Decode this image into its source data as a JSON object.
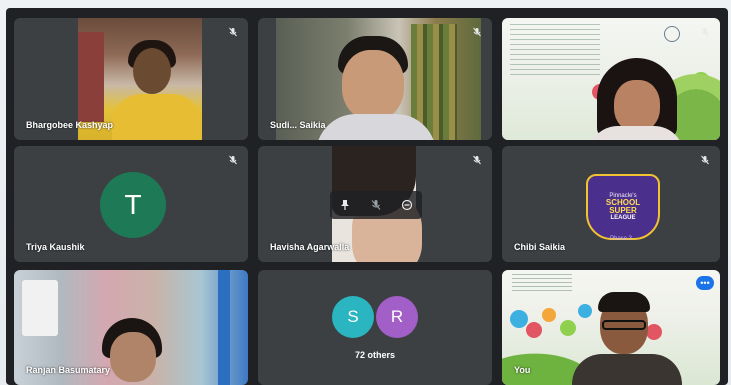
{
  "participants": [
    {
      "name": "Bhargobee Kashyap",
      "muted": true
    },
    {
      "name": "Sudi... Saikia",
      "muted": true
    },
    {
      "name": "",
      "muted": true
    },
    {
      "name": "Triya Kaushik",
      "muted": true,
      "avatar_letter": "T",
      "avatar_color": "#1e7a56"
    },
    {
      "name": "Havisha Agarwalla",
      "muted": true
    },
    {
      "name": "Chibi Saikia",
      "muted": true,
      "badge": {
        "top": "Pinnacle's",
        "line1": "SCHOOL",
        "line2": "SUPER",
        "line3": "LEAGUE",
        "foot": "Phase 3"
      }
    },
    {
      "name": "Ranjan Basumatary",
      "muted": false
    },
    {
      "name": "",
      "others_count_label": "72 others",
      "avatars": [
        {
          "letter": "S",
          "color": "#2ab5c0"
        },
        {
          "letter": "R",
          "color": "#a35fc8"
        }
      ]
    },
    {
      "name": "You",
      "muted": false
    }
  ],
  "self_tile_controls": [
    "pin-icon",
    "mic-off-icon",
    "remove-icon"
  ],
  "self_view_menu": "more-options-icon",
  "colors": {
    "tile_bg": "#3c4043",
    "grid_bg": "#1f2124",
    "accent": "#1a73e8"
  }
}
